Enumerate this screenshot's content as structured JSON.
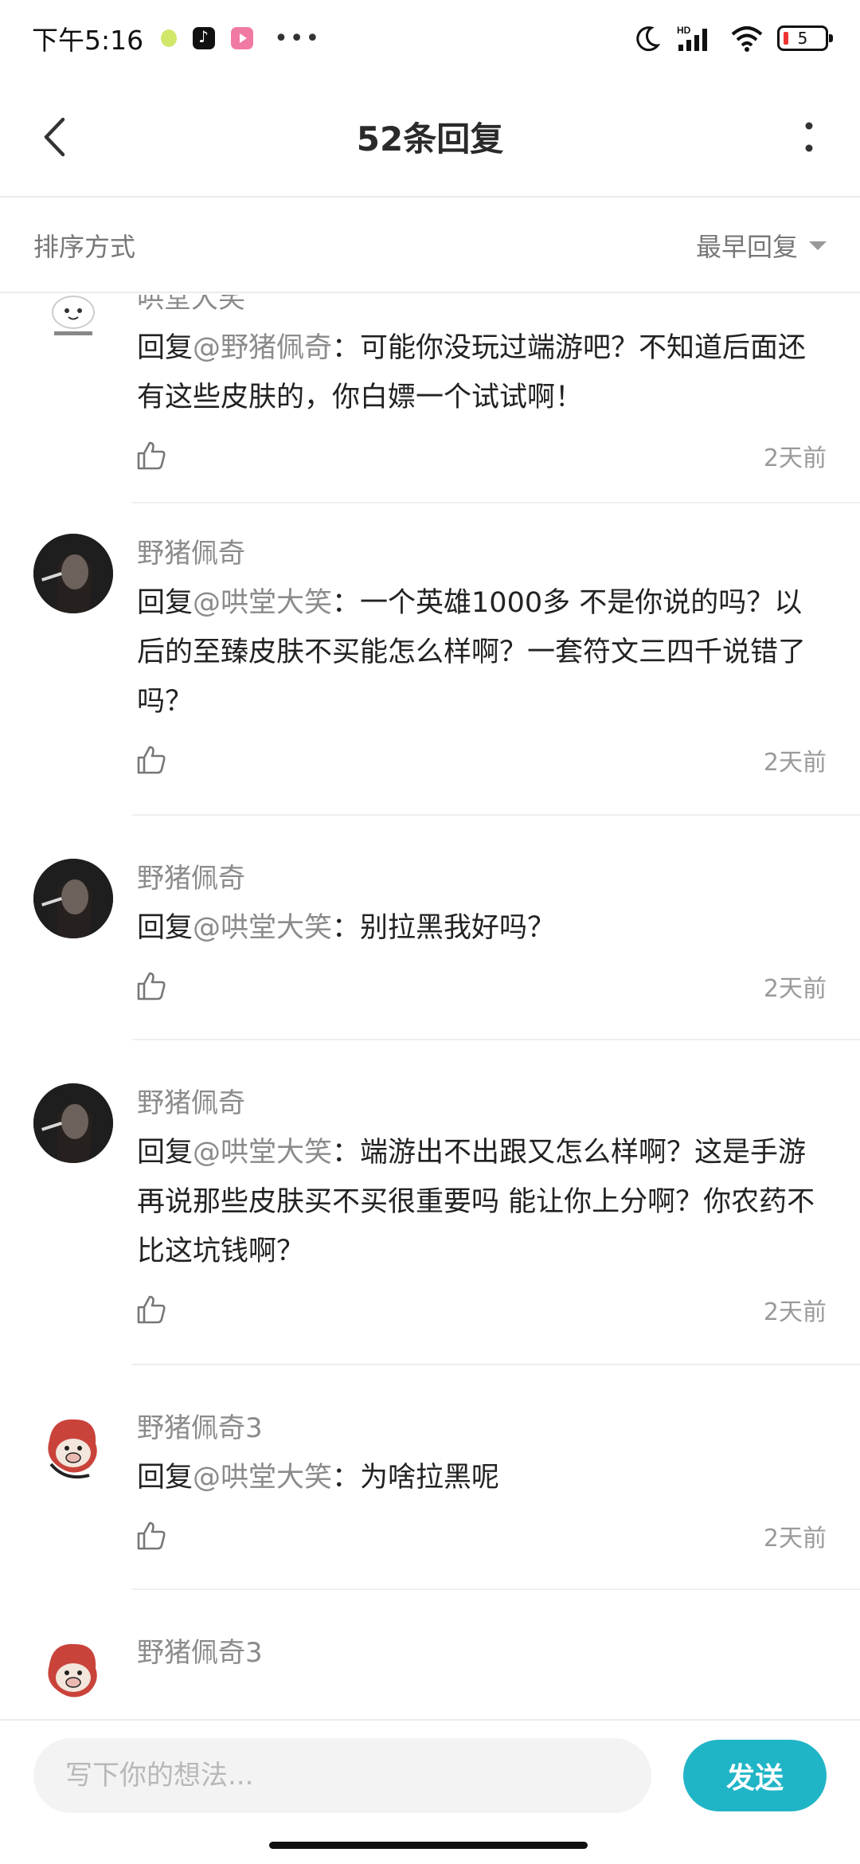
{
  "status_bar": {
    "time": "下午5:16",
    "more": "•••",
    "network": "HD",
    "battery": "5"
  },
  "header": {
    "title": "52条回复"
  },
  "sort": {
    "label": "排序方式",
    "value": "最早回复"
  },
  "replies": [
    {
      "author": "哄堂大笑",
      "reply_prefix": "回复",
      "mention": "@野猪佩奇",
      "text": "：可能你没玩过端游吧？不知道后面还有这些皮肤的，你白嫖一个试试啊！",
      "time": "2天前",
      "avatar": "meme-avatar"
    },
    {
      "author": "野猪佩奇",
      "reply_prefix": "回复",
      "mention": "@哄堂大笑",
      "text": "：一个英雄1000多 不是你说的吗？以后的至臻皮肤不买能怎么样啊？一套符文三四千说错了吗？",
      "time": "2天前",
      "avatar": "photo-avatar"
    },
    {
      "author": "野猪佩奇",
      "reply_prefix": "回复",
      "mention": "@哄堂大笑",
      "text": "：别拉黑我好吗？",
      "time": "2天前",
      "avatar": "photo-avatar"
    },
    {
      "author": "野猪佩奇",
      "reply_prefix": "回复",
      "mention": "@哄堂大笑",
      "text": "：端游出不出跟又怎么样啊？这是手游 再说那些皮肤买不买很重要吗 能让你上分啊？你农药不比这坑钱啊？",
      "time": "2天前",
      "avatar": "photo-avatar"
    },
    {
      "author": "野猪佩奇3",
      "reply_prefix": "回复",
      "mention": "@哄堂大笑",
      "text": "：为啥拉黑呢",
      "time": "2天前",
      "avatar": "cartoon-avatar"
    },
    {
      "author": "野猪佩奇3",
      "avatar": "cartoon-avatar"
    }
  ],
  "composer": {
    "placeholder": "写下你的想法...",
    "send_label": "发送"
  },
  "colors": {
    "accent": "#20b5c6",
    "mention": "#8b8b8b"
  },
  "icons": [
    "back-arrow-icon",
    "more-vertical-icon",
    "caret-down-icon",
    "thumbs-up-icon"
  ]
}
